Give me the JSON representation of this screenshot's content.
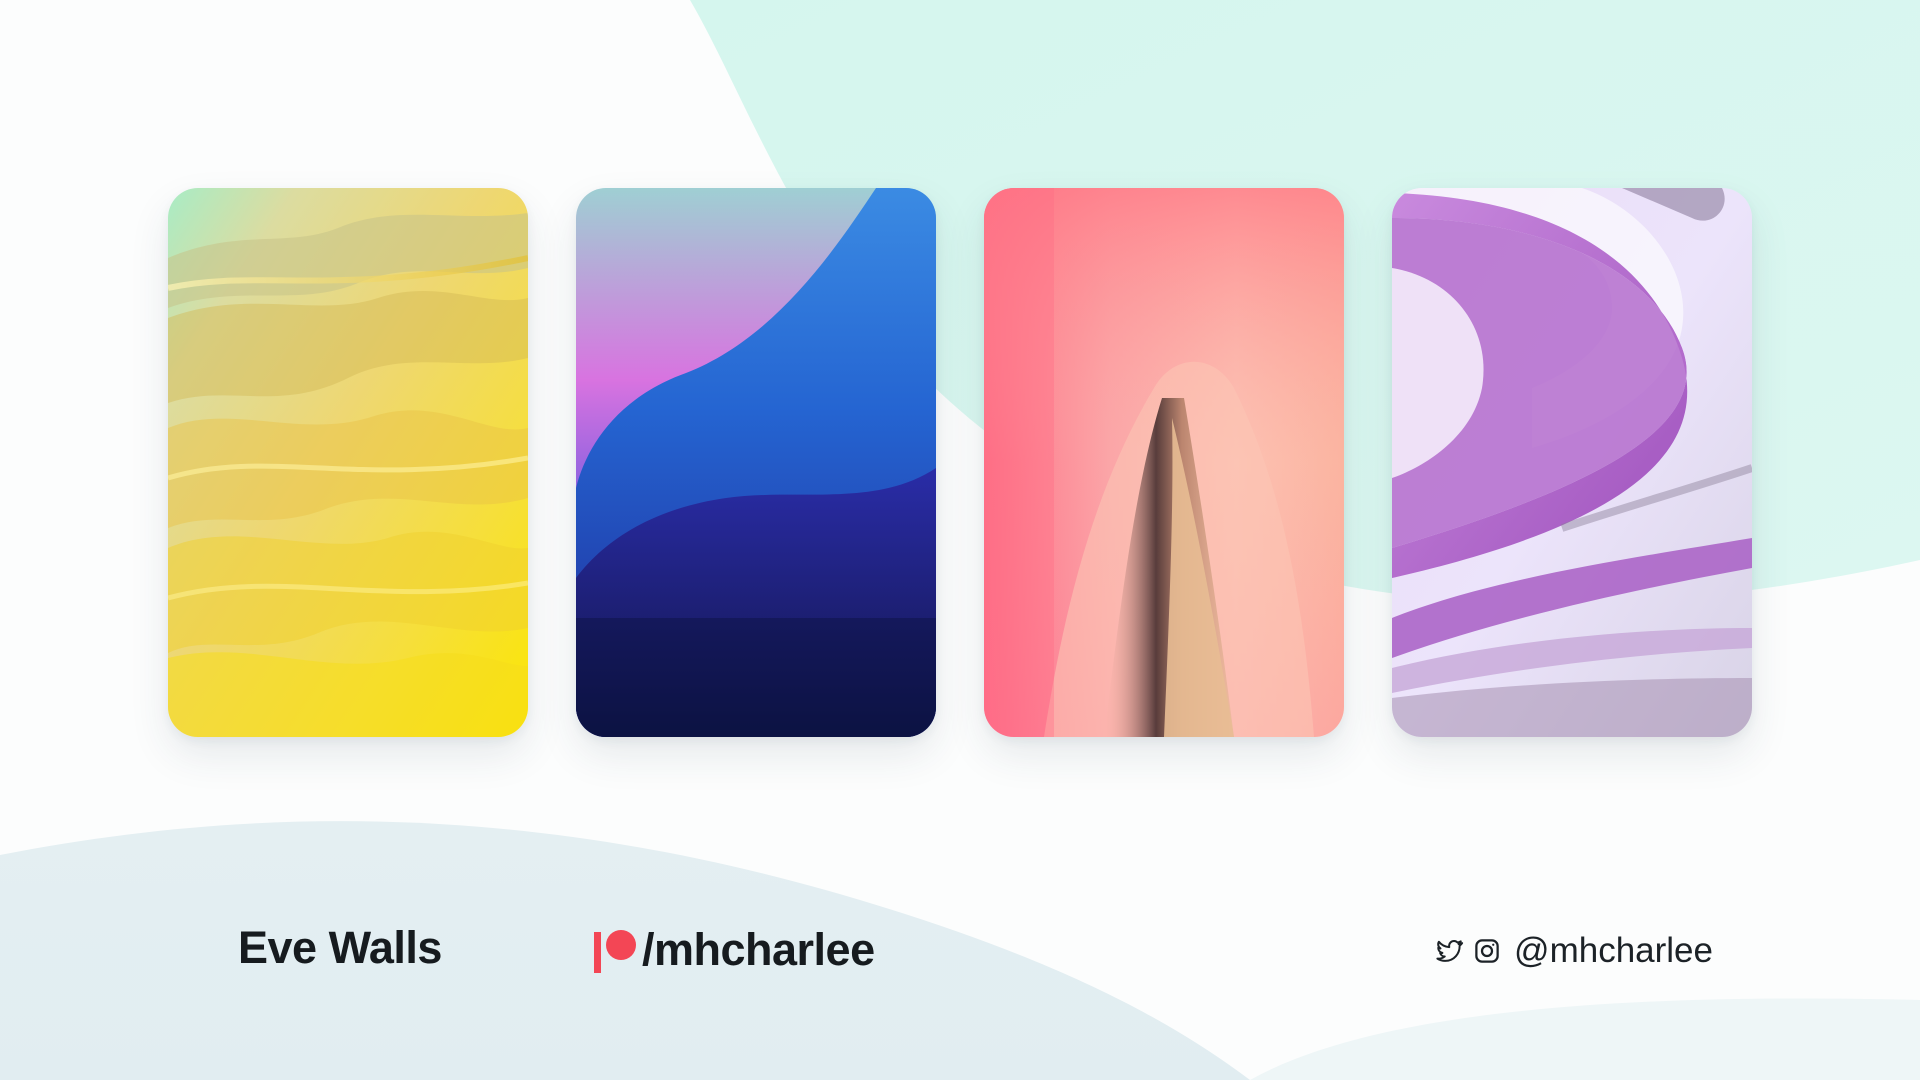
{
  "colors": {
    "background_mint": "#d8f6ef",
    "background_bottom": "#e3eff2",
    "text_dark": "#161b1f",
    "patreon_red": "#f34655"
  },
  "wallpapers": [
    {
      "name": "yellow-waves-wallpaper",
      "palette": [
        "#9fe9c4",
        "#e9df9a",
        "#f2d430",
        "#fbe800"
      ]
    },
    {
      "name": "blue-purple-gradient-wallpaper",
      "palette": [
        "#a9c9d6",
        "#d86ee3",
        "#2f6ed8",
        "#111449"
      ]
    },
    {
      "name": "pink-blur-wallpaper",
      "palette": [
        "#ff7f86",
        "#fbb7ae",
        "#3a2a2a",
        "#f5b995"
      ]
    },
    {
      "name": "purple-ribbon-wallpaper",
      "palette": [
        "#d9c9f3",
        "#b96bd1",
        "#eee6fb",
        "#9d8fa8"
      ]
    }
  ],
  "footer": {
    "brand": "Eve Walls",
    "patreon_handle": "/mhcharlee",
    "patreon_icon": "patreon-icon",
    "twitter_icon": "twitter-icon",
    "instagram_icon": "instagram-icon",
    "social_handle": "@mhcharlee"
  }
}
